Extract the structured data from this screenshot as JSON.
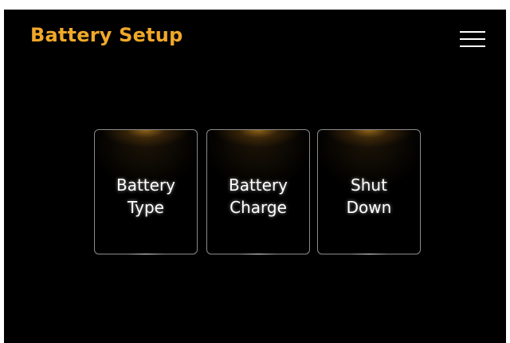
{
  "header": {
    "title": "Battery Setup",
    "menu_icon": "hamburger-menu-icon"
  },
  "tiles": [
    {
      "label": "Battery\nType"
    },
    {
      "label": "Battery\nCharge"
    },
    {
      "label": "Shut\nDown"
    }
  ],
  "colors": {
    "background": "#000000",
    "accent": "#f0a82a",
    "text": "#ffffff",
    "tile_border": "#8a8a8a"
  }
}
